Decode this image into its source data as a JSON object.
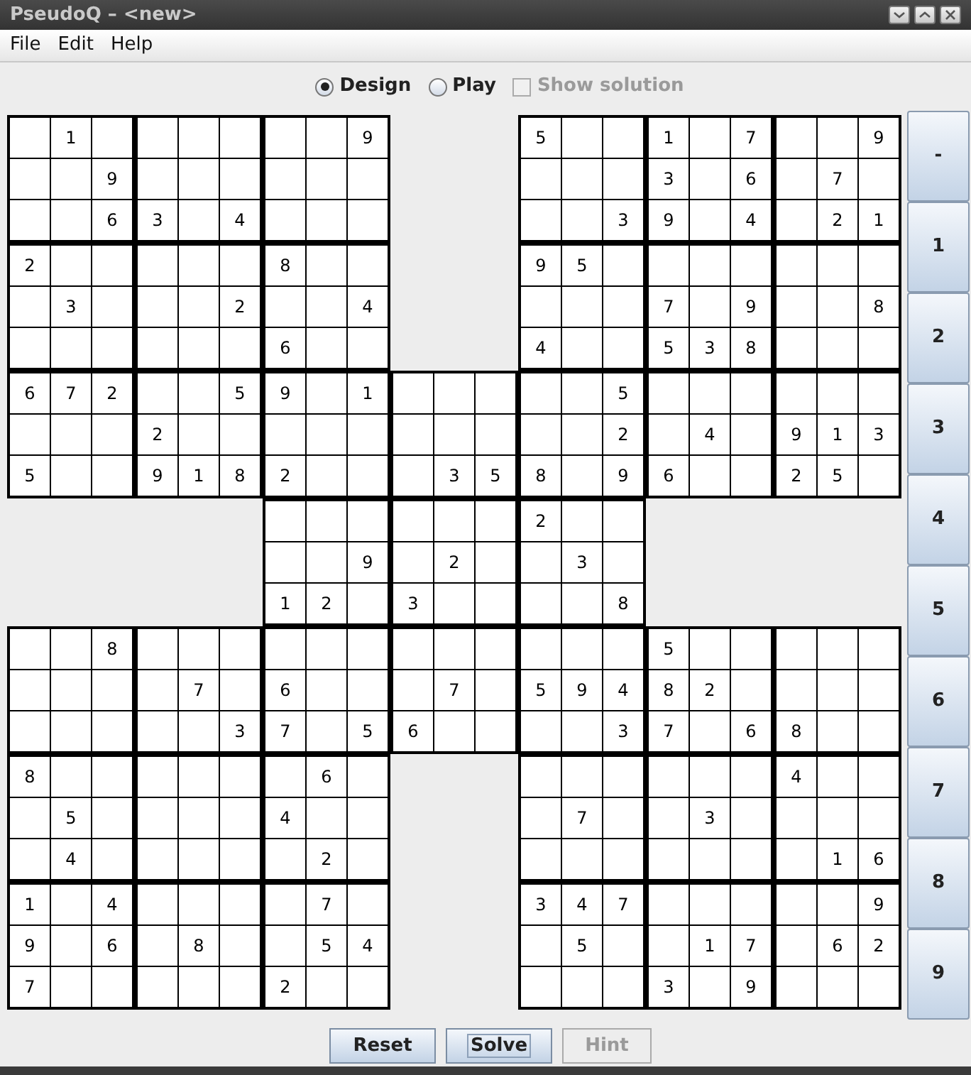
{
  "window": {
    "title": "PseudoQ – <new>"
  },
  "menu": [
    {
      "label": "File"
    },
    {
      "label": "Edit"
    },
    {
      "label": "Help"
    }
  ],
  "mode_options": [
    {
      "kind": "radio",
      "label": "Design",
      "selected": true,
      "disabled": false
    },
    {
      "kind": "radio",
      "label": "Play",
      "selected": false,
      "disabled": false
    },
    {
      "kind": "checkbox",
      "label": "Show solution",
      "checked": false,
      "disabled": true
    }
  ],
  "board": {
    "rows": [
      [
        {},
        {
          "v": "1"
        },
        {},
        {},
        {},
        {},
        {},
        {},
        {
          "v": "9"
        },
        null,
        null,
        null,
        {
          "v": "5"
        },
        {},
        {},
        {
          "v": "1"
        },
        {},
        {
          "v": "7"
        },
        {},
        {},
        {
          "v": "9"
        }
      ],
      [
        {},
        {},
        {
          "v": "9"
        },
        {},
        {},
        {},
        {},
        {},
        {},
        null,
        null,
        null,
        {},
        {},
        {},
        {
          "v": "3"
        },
        {},
        {
          "v": "6"
        },
        {},
        {
          "v": "7"
        },
        {}
      ],
      [
        {},
        {},
        {
          "v": "6"
        },
        {
          "v": "3"
        },
        {},
        {
          "v": "4"
        },
        {},
        {},
        {},
        null,
        null,
        null,
        {},
        {},
        {
          "v": "3"
        },
        {
          "v": "9"
        },
        {},
        {
          "v": "4"
        },
        {},
        {
          "v": "2"
        },
        {
          "v": "1"
        }
      ],
      [
        {
          "v": "2"
        },
        {},
        {},
        {},
        {},
        {},
        {
          "v": "8"
        },
        {},
        {},
        null,
        null,
        null,
        {
          "v": "9"
        },
        {
          "v": "5"
        },
        {},
        {},
        {},
        {},
        {},
        {},
        {}
      ],
      [
        {},
        {
          "v": "3"
        },
        {},
        {},
        {},
        {
          "v": "2"
        },
        {},
        {},
        {
          "v": "4"
        },
        null,
        null,
        null,
        {},
        {},
        {},
        {
          "v": "7"
        },
        {},
        {
          "v": "9"
        },
        {},
        {},
        {
          "v": "8"
        }
      ],
      [
        {},
        {},
        {},
        {},
        {},
        {},
        {
          "v": "6"
        },
        {},
        {},
        null,
        null,
        null,
        {
          "v": "4"
        },
        {},
        {},
        {
          "v": "5"
        },
        {
          "v": "3"
        },
        {
          "v": "8"
        },
        {},
        {},
        {}
      ],
      [
        {
          "v": "6"
        },
        {
          "v": "7"
        },
        {
          "v": "2"
        },
        {},
        {},
        {
          "v": "5"
        },
        {
          "v": "9"
        },
        {},
        {
          "v": "1"
        },
        {},
        {},
        {},
        {},
        {},
        {
          "v": "5"
        },
        {},
        {},
        {},
        {},
        {},
        {}
      ],
      [
        {},
        {},
        {},
        {
          "v": "2"
        },
        {},
        {},
        {},
        {},
        {},
        {},
        {},
        {},
        {},
        {},
        {
          "v": "2"
        },
        {},
        {
          "v": "4"
        },
        {},
        {
          "v": "9"
        },
        {
          "v": "1"
        },
        {
          "v": "3"
        }
      ],
      [
        {
          "v": "5"
        },
        {},
        {},
        {
          "v": "9"
        },
        {
          "v": "1"
        },
        {
          "v": "8"
        },
        {
          "v": "2"
        },
        {},
        {},
        {},
        {
          "v": "3"
        },
        {
          "v": "5"
        },
        {
          "v": "8"
        },
        {},
        {
          "v": "9"
        },
        {
          "v": "6"
        },
        {},
        {},
        {
          "v": "2"
        },
        {
          "v": "5"
        },
        {}
      ],
      [
        null,
        null,
        null,
        null,
        null,
        null,
        {},
        {},
        {},
        {},
        {},
        {},
        {
          "v": "2"
        },
        {},
        {},
        null,
        null,
        null,
        null,
        null,
        null
      ],
      [
        null,
        null,
        null,
        null,
        null,
        null,
        {},
        {},
        {
          "v": "9"
        },
        {},
        {
          "v": "2"
        },
        {},
        {},
        {
          "v": "3"
        },
        {},
        null,
        null,
        null,
        null,
        null,
        null
      ],
      [
        null,
        null,
        null,
        null,
        null,
        null,
        {
          "v": "1"
        },
        {
          "v": "2"
        },
        {},
        {
          "v": "3"
        },
        {},
        {},
        {},
        {},
        {
          "v": "8"
        },
        null,
        null,
        null,
        null,
        null,
        null
      ],
      [
        {},
        {},
        {
          "v": "8"
        },
        {},
        {},
        {},
        {},
        {},
        {},
        {},
        {},
        {},
        {},
        {},
        {},
        {
          "v": "5"
        },
        {},
        {},
        {},
        {},
        {}
      ],
      [
        {},
        {},
        {},
        {},
        {
          "v": "7"
        },
        {},
        {
          "v": "6"
        },
        {},
        {},
        {},
        {
          "v": "7"
        },
        {},
        {
          "v": "5"
        },
        {
          "v": "9"
        },
        {
          "v": "4"
        },
        {
          "v": "8"
        },
        {
          "v": "2"
        },
        {},
        {},
        {},
        {}
      ],
      [
        {},
        {},
        {},
        {},
        {},
        {
          "v": "3"
        },
        {
          "v": "7"
        },
        {},
        {
          "v": "5"
        },
        {
          "v": "6"
        },
        {},
        {},
        {},
        {},
        {
          "v": "3"
        },
        {
          "v": "7"
        },
        {},
        {
          "v": "6"
        },
        {
          "v": "8"
        },
        {},
        {}
      ],
      [
        {
          "v": "8"
        },
        {},
        {},
        {},
        {},
        {},
        {},
        {
          "v": "6"
        },
        {},
        null,
        null,
        null,
        {},
        {},
        {},
        {},
        {},
        {},
        {
          "v": "4"
        },
        {},
        {}
      ],
      [
        {},
        {
          "v": "5"
        },
        {},
        {},
        {},
        {},
        {
          "v": "4"
        },
        {},
        {},
        null,
        null,
        null,
        {},
        {
          "v": "7"
        },
        {},
        {},
        {
          "v": "3"
        },
        {},
        {},
        {},
        {}
      ],
      [
        {},
        {
          "v": "4"
        },
        {},
        {},
        {},
        {},
        {},
        {
          "v": "2"
        },
        {},
        null,
        null,
        null,
        {},
        {},
        {},
        {},
        {},
        {},
        {},
        {
          "v": "1"
        },
        {
          "v": "6"
        }
      ],
      [
        {
          "v": "1"
        },
        {},
        {
          "v": "4"
        },
        {},
        {},
        {},
        {},
        {
          "v": "7"
        },
        {},
        null,
        null,
        null,
        {
          "v": "3"
        },
        {
          "v": "4"
        },
        {
          "v": "7"
        },
        {},
        {},
        {},
        {},
        {},
        {
          "v": "9"
        }
      ],
      [
        {
          "v": "9"
        },
        {},
        {
          "v": "6"
        },
        {},
        {
          "v": "8"
        },
        {},
        {},
        {
          "v": "5"
        },
        {
          "v": "4"
        },
        null,
        null,
        null,
        {},
        {
          "v": "5"
        },
        {},
        {},
        {
          "v": "1"
        },
        {
          "v": "7"
        },
        {},
        {
          "v": "6"
        },
        {
          "v": "2"
        }
      ],
      [
        {
          "v": "7"
        },
        {},
        {},
        {},
        {},
        {},
        {
          "v": "2"
        },
        {},
        {},
        null,
        null,
        null,
        {},
        {},
        {},
        {
          "v": "3"
        },
        {},
        {
          "v": "9"
        },
        {},
        {},
        {}
      ]
    ]
  },
  "number_buttons": [
    "-",
    "1",
    "2",
    "3",
    "4",
    "5",
    "6",
    "7",
    "8",
    "9"
  ],
  "actions": [
    {
      "label": "Reset",
      "disabled": false,
      "focused": false
    },
    {
      "label": "Solve",
      "disabled": false,
      "focused": true
    },
    {
      "label": "Hint",
      "disabled": true,
      "focused": false
    }
  ]
}
